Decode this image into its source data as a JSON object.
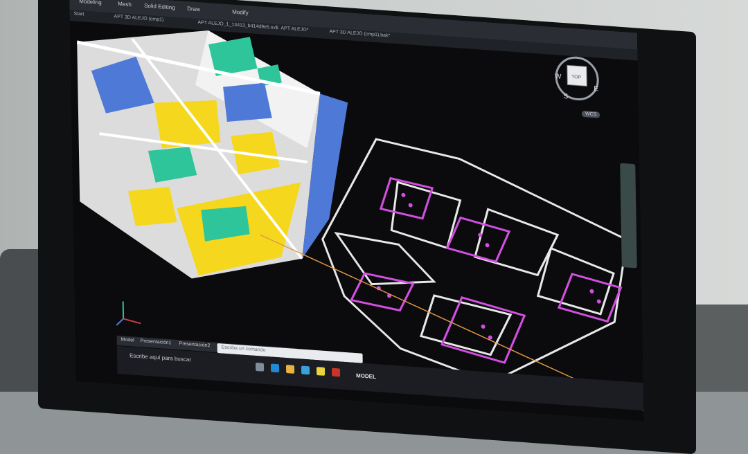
{
  "ribbon": {
    "workspace": "Modeling",
    "menu_mesh": "Mesh",
    "menu_solid": "Solid Editing",
    "menu_draw": "Draw",
    "menu_modify": "Modify"
  },
  "tabs": [
    {
      "label": "APT 3D  ALEJO (cmp1)"
    },
    {
      "label": "APT ALEJO_1_13413_b414d9e5.sv$"
    },
    {
      "label": "APT ALEJO*"
    },
    {
      "label": "APT 3D  ALEJO (cmp1).bak*"
    }
  ],
  "start_label": "Start",
  "viewcube": {
    "top": "TOP",
    "north": "W",
    "east": "E",
    "south": "S",
    "wcs": "WCS"
  },
  "model_tabs": [
    "Model",
    "Presentación1",
    "Presentación2"
  ],
  "cmd_placeholder": "Escriba un comando",
  "taskbar": {
    "search_placeholder": "Escribe aquí para buscar",
    "mode": "MODEL"
  },
  "colors": {
    "wall": "#f2f2f2",
    "floor": "#f5d81e",
    "blue": "#4f79d6",
    "teal": "#2ec59a",
    "magenta": "#d24fe0",
    "orange": "#e39a45"
  },
  "corner_glyphs": "▪▪ ▪"
}
